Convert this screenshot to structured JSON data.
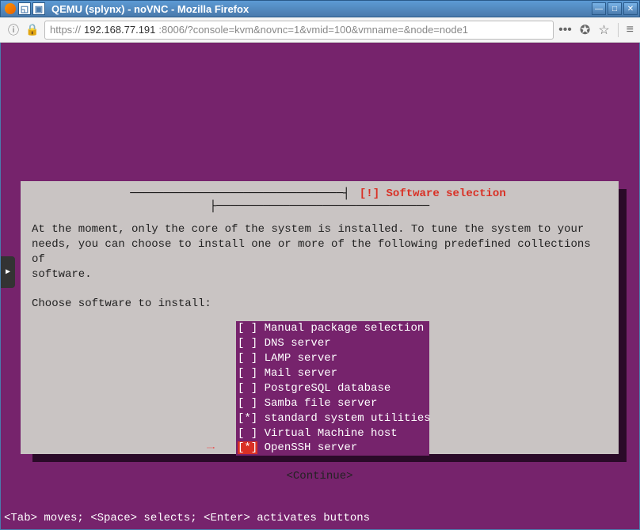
{
  "window": {
    "title": "QEMU (splynx) - noVNC - Mozilla Firefox"
  },
  "url": {
    "scheme": "https://",
    "ip": "192.168.77.191",
    "rest": ":8006/?console=kvm&novnc=1&vmid=100&vmname=&node=node1"
  },
  "installer": {
    "title": "[!] Software selection",
    "body_text": "At the moment, only the core of the system is installed. To tune the system to your\nneeds, you can choose to install one or more of the following predefined collections of\nsoftware.\n\nChoose software to install:",
    "items": [
      {
        "mark": " ",
        "label": "Manual package selection",
        "hi": false
      },
      {
        "mark": " ",
        "label": "DNS server",
        "hi": false
      },
      {
        "mark": " ",
        "label": "LAMP server",
        "hi": false
      },
      {
        "mark": " ",
        "label": "Mail server",
        "hi": false
      },
      {
        "mark": " ",
        "label": "PostgreSQL database",
        "hi": false
      },
      {
        "mark": " ",
        "label": "Samba file server",
        "hi": false
      },
      {
        "mark": "*",
        "label": "standard system utilities",
        "hi": false
      },
      {
        "mark": " ",
        "label": "Virtual Machine host",
        "hi": false
      },
      {
        "mark": "*",
        "label": "OpenSSH server",
        "hi": true
      }
    ],
    "continue_label": "<Continue>"
  },
  "hint": "<Tab> moves; <Space> selects; <Enter> activates buttons"
}
